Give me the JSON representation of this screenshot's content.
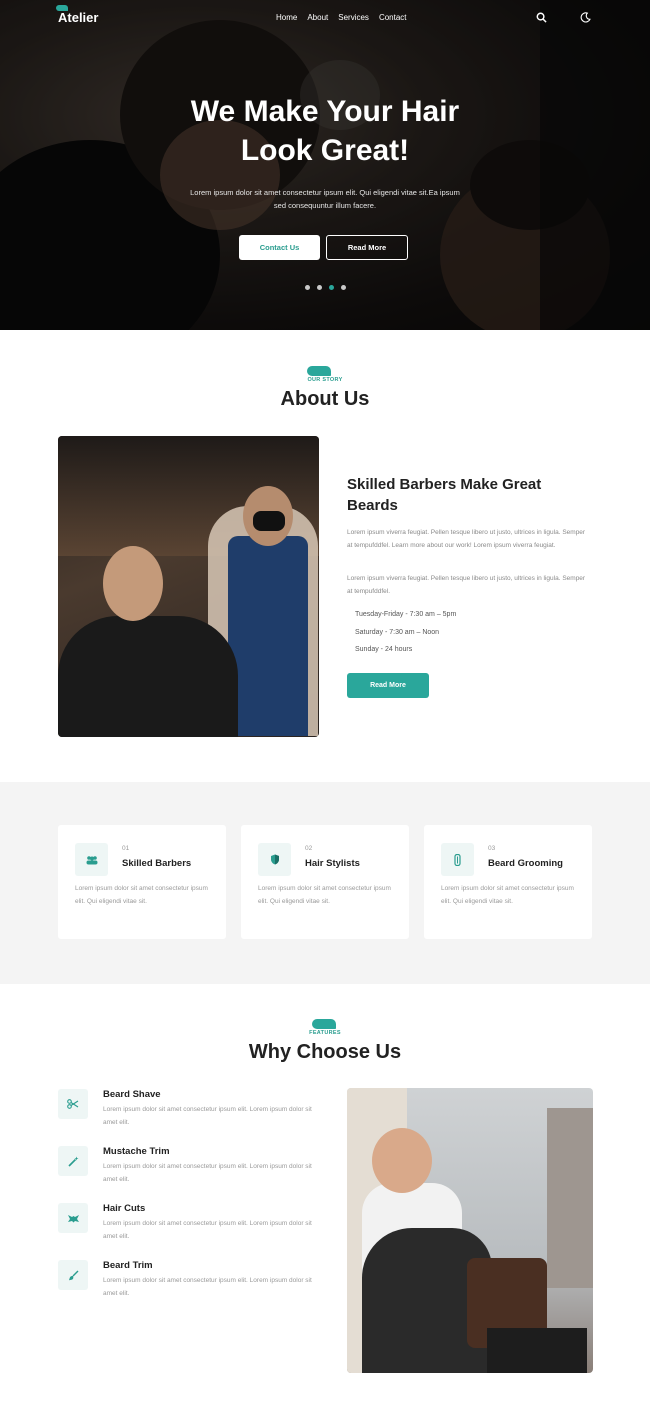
{
  "nav": {
    "logo": "Atelier",
    "menu": [
      "Home",
      "About",
      "Services",
      "Contact"
    ],
    "icons": [
      "search-icon",
      "moon-icon"
    ]
  },
  "hero": {
    "title_line1": "We Make Your Hair",
    "title_line2": "Look Great!",
    "subtitle": "Lorem ipsum dolor sit amet consectetur ipsum elit. Qui eligendi vitae sit.Ea ipsum sed consequuntur illum facere.",
    "contact_button": "Contact Us",
    "read_more_button": "Read More",
    "slides": 4,
    "active_slide": 3
  },
  "about": {
    "tag": "OUR STORY",
    "title": "About Us",
    "heading": "Skilled Barbers Make Great Beards",
    "para1": "Lorem ipsum viverra feugiat. Pellen tesque libero ut justo, ultrices in ligula. Semper at tempufddfel. Learn more about our work! Lorem ipsum viverra feugiat.",
    "para2": "Lorem ipsum viverra feugiat. Pellen tesque libero ut justo, ultrices in ligula. Semper at tempufddfel.",
    "hours": [
      "Tuesday-Friday - 7:30 am – 5pm",
      "Saturday - 7:30 am – Noon",
      "Sunday - 24 hours"
    ],
    "button": "Read More"
  },
  "features": [
    {
      "num": "01",
      "title": "Skilled Barbers",
      "text": "Lorem ipsum dolor sit amet consectetur ipsum elit. Qui eligendi vitae sit.",
      "icon": "users-icon"
    },
    {
      "num": "02",
      "title": "Hair Stylists",
      "text": "Lorem ipsum dolor sit amet consectetur ipsum elit. Qui eligendi vitae sit.",
      "icon": "shield-icon"
    },
    {
      "num": "03",
      "title": "Beard Grooming",
      "text": "Lorem ipsum dolor sit amet consectetur ipsum elit. Qui eligendi vitae sit.",
      "icon": "comb-icon"
    }
  ],
  "why": {
    "tag": "FEATURES",
    "title": "Why Choose Us",
    "items": [
      {
        "title": "Beard Shave",
        "text": "Lorem ipsum dolor sit amet consectetur ipsum elit. Lorem ipsum dolor sit amet elit.",
        "icon": "scissors-icon"
      },
      {
        "title": "Mustache Trim",
        "text": "Lorem ipsum dolor sit amet consectetur ipsum elit. Lorem ipsum dolor sit amet elit.",
        "icon": "wand-icon"
      },
      {
        "title": "Hair Cuts",
        "text": "Lorem ipsum dolor sit amet consectetur ipsum elit. Lorem ipsum dolor sit amet elit.",
        "icon": "clipper-icon"
      },
      {
        "title": "Beard Trim",
        "text": "Lorem ipsum dolor sit amet consectetur ipsum elit. Lorem ipsum dolor sit amet elit.",
        "icon": "brush-icon"
      }
    ]
  },
  "colors": {
    "accent": "#2aa79b",
    "dark": "#222222",
    "muted": "#9a9a9a",
    "band": "#f4f4f4"
  }
}
